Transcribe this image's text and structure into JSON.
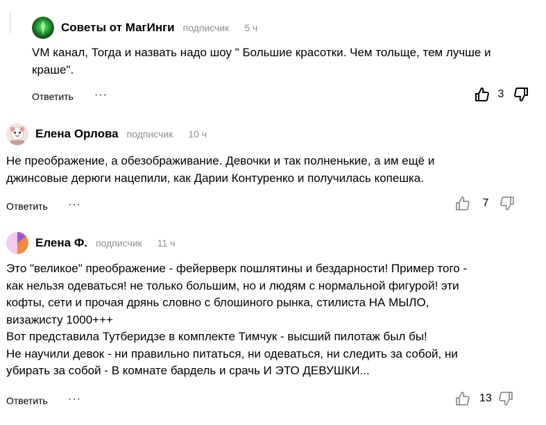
{
  "comments": [
    {
      "author": "Советы от МагИнги",
      "badge": "подписчик",
      "time": "5 ч",
      "text": "VM канал, Тогда и назвать надо шоу \" Большие красотки. Чем тольще, тем лучше и\nкраше\".",
      "reply_label": "Ответить",
      "more_label": "···",
      "likes": "3",
      "avatar_colors": [
        "#0b3d12",
        "#2fb83a"
      ]
    },
    {
      "author": "Елена Орлова",
      "badge": "подписчик",
      "time": "10 ч",
      "text": "Не преображение, а обезображивание. Девочки и так полненькие, а им ещё и\nджинсовые дерюги нацепили, как Дарии Контуренко и получилась копешка.",
      "reply_label": "Ответить",
      "more_label": "···",
      "likes": "7",
      "avatar_colors": [
        "#e8d5c8",
        "#b47a7a"
      ]
    },
    {
      "author": "Елена Ф.",
      "badge": "подписчик",
      "time": "11 ч",
      "text": "Это \"великое\" преображение - фейерверк пошлятины и бездарности! Пример того -\nкак нельзя одеваться! не только большим, но и людям с нормальной фигурой! эти\nкофты, сети и прочая дрянь словно с блошиного рынка, стилиста НА МЫЛО,\nвизажисту 1000+++\nВот представила Тутберидзе в комплекте Тимчук - высший пилотаж был бы!\nНе научили девок - ни правильно питаться, ни одеваться, ни следить за собой, ни\nубирать за собой - В комнате бардель и срачь И ЭТО ДЕВУШКИ...",
      "reply_label": "Ответить",
      "more_label": "···",
      "likes": "13",
      "avatar_colors": [
        "#f6c9ef",
        "#f08a3c",
        "#9b59d6"
      ]
    }
  ],
  "icons": [
    "like-icon",
    "dislike-icon"
  ]
}
